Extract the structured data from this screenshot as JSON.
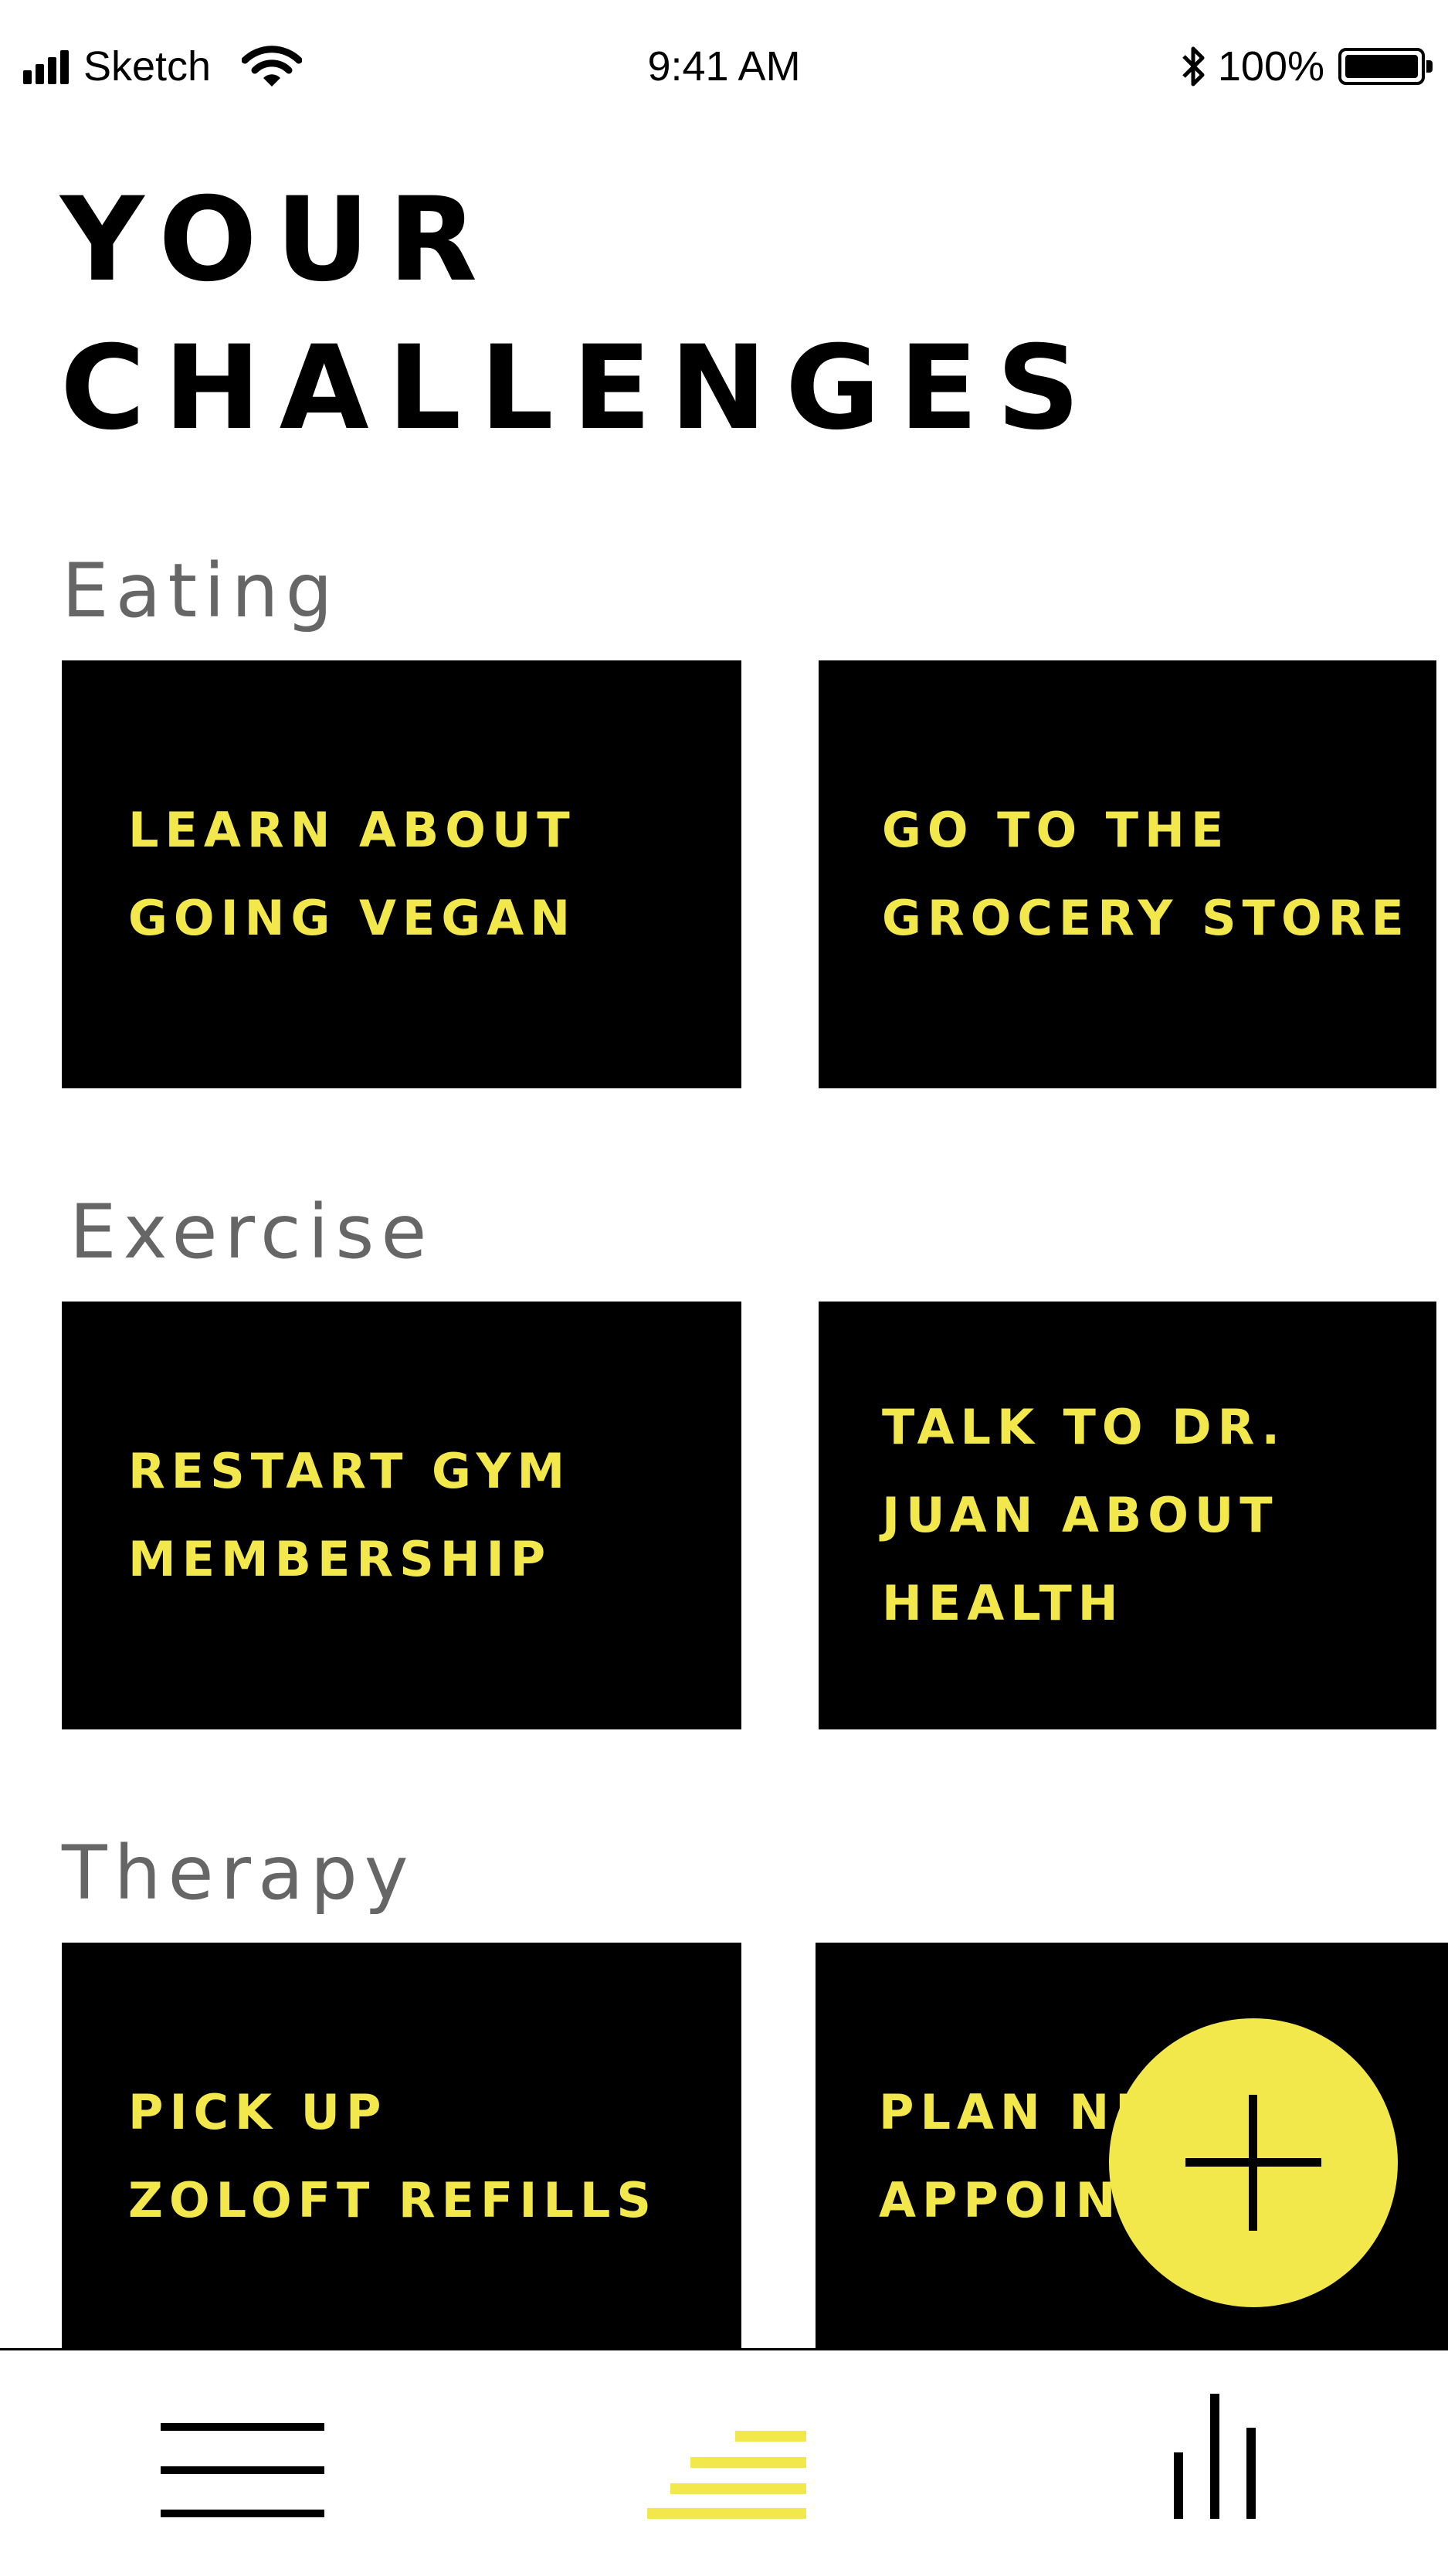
{
  "status_bar": {
    "carrier": "Sketch",
    "time": "9:41 AM",
    "battery_percent": "100%",
    "battery_level": 1.0,
    "signal_bars": 4,
    "icons": [
      "signal-icon",
      "wifi-icon",
      "bluetooth-icon",
      "battery-icon"
    ]
  },
  "page_title_lines": [
    "YOUR",
    "CHALLENGES"
  ],
  "sections": [
    {
      "label": "Eating",
      "cards": [
        {
          "lines": [
            "LEARN ABOUT",
            "GOING VEGAN"
          ]
        },
        {
          "lines": [
            "GO TO THE",
            "GROCERY STORE"
          ]
        }
      ]
    },
    {
      "label": "Exercise",
      "cards": [
        {
          "lines": [
            "RESTART GYM",
            "MEMBERSHIP"
          ]
        },
        {
          "lines": [
            "TALK TO DR.",
            "JUAN ABOUT",
            "HEALTH"
          ]
        }
      ]
    },
    {
      "label": "Therapy",
      "cards": [
        {
          "lines": [
            "PICK UP",
            "ZOLOFT REFILLS"
          ]
        },
        {
          "lines": [
            "PLAN NEXT",
            "APPOINTMENT"
          ]
        }
      ]
    }
  ],
  "fab": {
    "icon": "plus-icon"
  },
  "tab_bar": {
    "tabs": [
      {
        "icon": "menu-icon",
        "active": false
      },
      {
        "icon": "challenges-icon",
        "active": true
      },
      {
        "icon": "stats-icon",
        "active": false
      }
    ]
  },
  "colors": {
    "accent_yellow": "#f2e84b",
    "card_background": "#000000",
    "section_label": "#666666",
    "background": "#ffffff"
  }
}
